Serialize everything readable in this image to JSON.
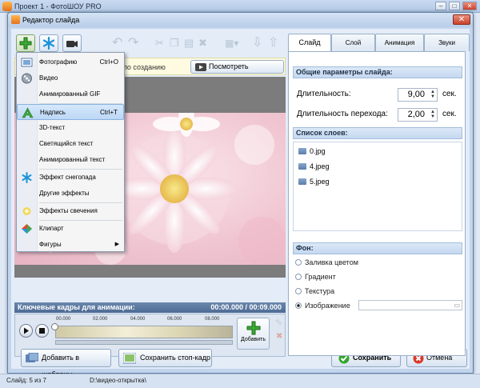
{
  "app": {
    "title": "Проект 1 - ФотоШОУ PRO"
  },
  "dialog": {
    "title": "Редактор слайда"
  },
  "hint": {
    "text": "по созданию",
    "video_button": "Посмотреть видеоурок"
  },
  "tabs": [
    "Слайд",
    "Слой",
    "Анимация",
    "Звуки"
  ],
  "slide_params": {
    "header": "Общие параметры слайда:",
    "duration_label": "Длительность:",
    "duration_value": "9,00",
    "duration_unit": "сек.",
    "transition_label": "Длительность перехода:",
    "transition_value": "2,00",
    "transition_unit": "сек."
  },
  "layers": {
    "header": "Список слоев:",
    "items": [
      "0.jpg",
      "4.jpeg",
      "5.jpeg"
    ]
  },
  "background": {
    "header": "Фон:",
    "options": [
      "Заливка цветом",
      "Градиент",
      "Текстура",
      "Изображение"
    ],
    "selected": "Изображение"
  },
  "keyframes": {
    "label": "Ключевые кадры для анимации:",
    "time": "00:00.000 / 00:09.000"
  },
  "timeline": {
    "ticks": [
      "00.000",
      "02.000",
      "04.000",
      "06.000",
      "08.000"
    ],
    "add_label": "Добавить"
  },
  "buttons": {
    "add_template": "Добавить в шаблоны",
    "save_frame": "Сохранить стоп-кадр",
    "save": "Сохранить",
    "cancel": "Отмена"
  },
  "menu": {
    "items": [
      {
        "label": "Фотографию",
        "shortcut": "Ctrl+O",
        "icon": "photo-icon"
      },
      {
        "label": "Видео",
        "shortcut": "",
        "icon": "film-reel-icon"
      },
      {
        "label": "Анимированный GIF",
        "shortcut": "",
        "icon": ""
      },
      {
        "label": "Надпись",
        "shortcut": "Ctrl+T",
        "icon": "text-a-icon"
      },
      {
        "label": "3D-текст",
        "shortcut": "",
        "icon": ""
      },
      {
        "label": "Светящийся текст",
        "shortcut": "",
        "icon": ""
      },
      {
        "label": "Анимированный текст",
        "shortcut": "",
        "icon": ""
      },
      {
        "label": "Эффект снегопада",
        "shortcut": "",
        "icon": "snowflake-icon"
      },
      {
        "label": "Другие эффекты",
        "shortcut": "",
        "icon": ""
      },
      {
        "label": "Эффекты свечения",
        "shortcut": "",
        "icon": "glow-icon"
      },
      {
        "label": "Клипарт",
        "shortcut": "",
        "icon": "clipart-icon"
      },
      {
        "label": "Фигуры",
        "shortcut": "",
        "icon": ""
      }
    ]
  },
  "status": {
    "slide": "Слайд: 5 из 7",
    "path": "D:\\видео-открытка\\"
  },
  "colors": {
    "accent": "#5b7eab",
    "keyframe_bar": "#5a789f",
    "highlight": "#c6ddf7"
  }
}
